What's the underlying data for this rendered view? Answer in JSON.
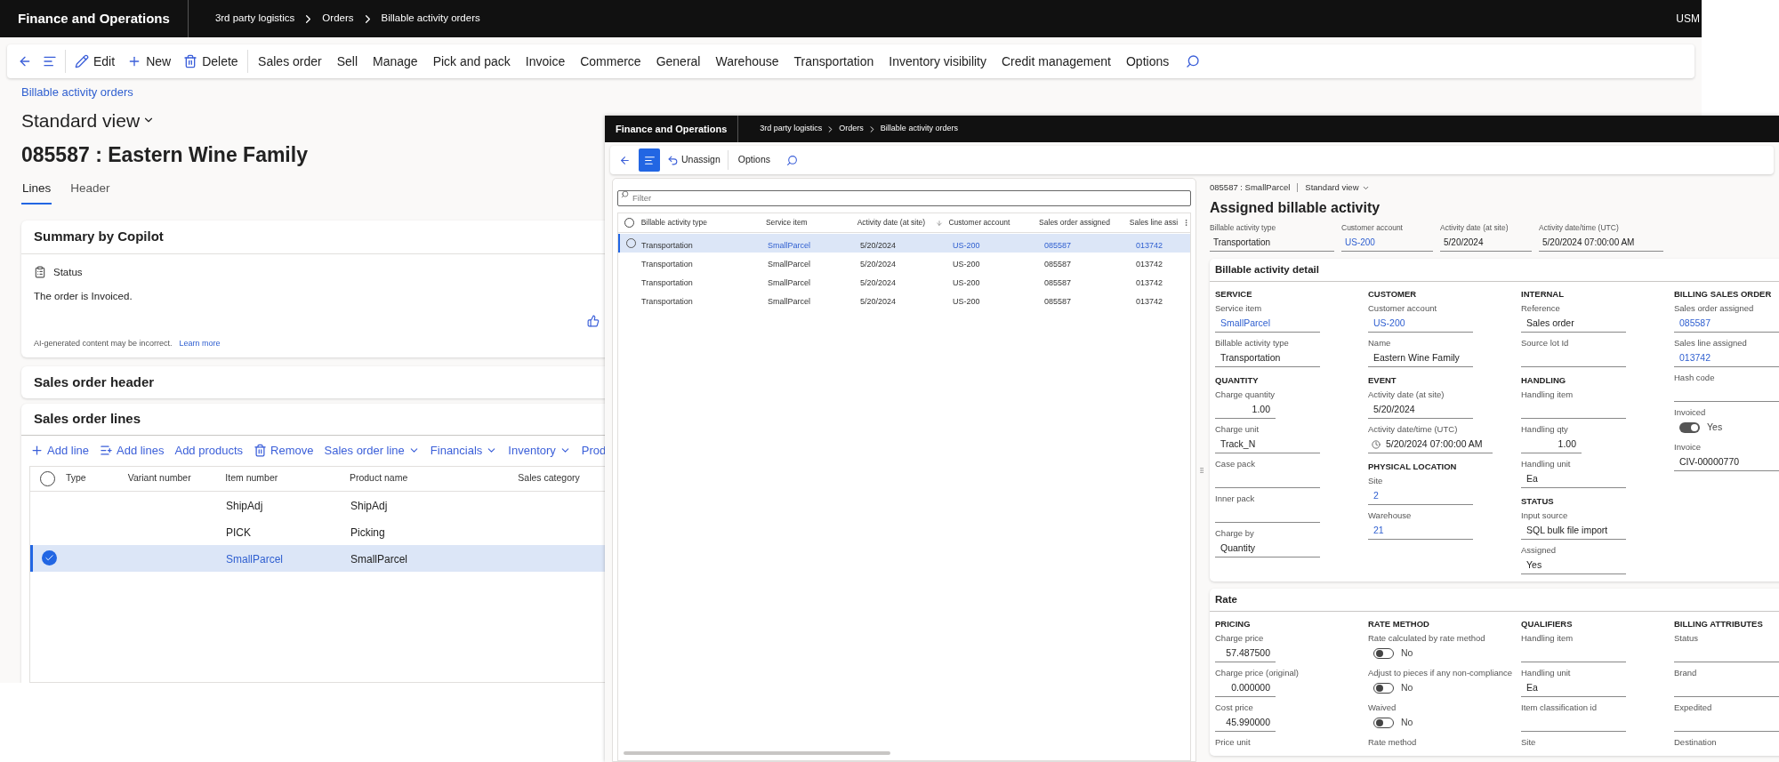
{
  "back_window": {
    "app_title": "Finance and Operations",
    "breadcrumb": [
      "3rd party logistics",
      "Orders",
      "Billable activity orders"
    ],
    "user": "USM",
    "toolbar": [
      {
        "kind": "back"
      },
      {
        "kind": "menu"
      },
      {
        "kind": "edit",
        "label": "Edit"
      },
      {
        "kind": "new",
        "label": "New"
      },
      {
        "kind": "delete",
        "label": "Delete"
      },
      {
        "kind": "text",
        "label": "Sales order"
      },
      {
        "kind": "text",
        "label": "Sell"
      },
      {
        "kind": "text",
        "label": "Manage"
      },
      {
        "kind": "text",
        "label": "Pick and pack"
      },
      {
        "kind": "text",
        "label": "Invoice"
      },
      {
        "kind": "text",
        "label": "Commerce"
      },
      {
        "kind": "text",
        "label": "General"
      },
      {
        "kind": "text",
        "label": "Warehouse"
      },
      {
        "kind": "text",
        "label": "Transportation"
      },
      {
        "kind": "text",
        "label": "Inventory visibility"
      },
      {
        "kind": "text",
        "label": "Credit management"
      },
      {
        "kind": "text",
        "label": "Options"
      },
      {
        "kind": "search"
      }
    ],
    "page_link": "Billable activity orders",
    "view": "Standard view",
    "title": "085587 : Eastern Wine Family",
    "tabs": [
      {
        "label": "Lines",
        "selected": true
      },
      {
        "label": "Header",
        "selected": false
      }
    ],
    "summary": {
      "title": "Summary by Copilot",
      "status_label": "Status",
      "text": "The order is Invoiced.",
      "disclaimer": "AI-generated content may be incorrect.",
      "link": "Learn more"
    },
    "header_section": {
      "title": "Sales order header"
    },
    "lines_section": {
      "title": "Sales order lines",
      "actions": [
        {
          "kind": "add",
          "label": "Add line"
        },
        {
          "kind": "add_multi",
          "label": "Add lines"
        },
        {
          "kind": "text",
          "label": "Add products"
        },
        {
          "kind": "remove",
          "label": "Remove"
        },
        {
          "kind": "dropdown",
          "label": "Sales order line"
        },
        {
          "kind": "dropdown",
          "label": "Financials"
        },
        {
          "kind": "dropdown",
          "label": "Inventory"
        },
        {
          "kind": "text",
          "label": "Prod"
        }
      ],
      "select_all": false,
      "columns": [
        "Type",
        "Variant number",
        "Item number",
        "Product name",
        "Sales category"
      ],
      "rows": [
        {
          "item_number": "ShipAdj",
          "product_name": "ShipAdj",
          "selected": false
        },
        {
          "item_number": "PICK",
          "product_name": "Picking",
          "selected": false
        },
        {
          "item_number": "SmallParcel",
          "product_name": "SmallParcel",
          "selected": true
        }
      ]
    }
  },
  "front_window": {
    "app_title": "Finance and Operations",
    "breadcrumb": [
      "3rd party logistics",
      "Orders",
      "Billable activity orders"
    ],
    "toolbar": [
      {
        "kind": "back"
      },
      {
        "kind": "menu_active"
      },
      {
        "kind": "unassign",
        "label": "Unassign"
      },
      {
        "kind": "text",
        "label": "Options"
      },
      {
        "kind": "search"
      }
    ],
    "list": {
      "filter_placeholder": "Filter",
      "select_all": false,
      "columns": [
        {
          "label": "Billable activity type",
          "link": false,
          "sorted": false
        },
        {
          "label": "Service item",
          "link": true,
          "sorted": false
        },
        {
          "label": "Activity date (at site)",
          "link": false,
          "sorted": true
        },
        {
          "label": "Customer account",
          "link": true,
          "sorted": false
        },
        {
          "label": "Sales order assigned",
          "link": true,
          "sorted": false
        },
        {
          "label": "Sales line assi",
          "link": true,
          "sorted": false
        }
      ],
      "rows": [
        {
          "cells": [
            "Transportation",
            "SmallParcel",
            "5/20/2024",
            "US-200",
            "085587",
            "013742"
          ],
          "selected": true
        },
        {
          "cells": [
            "Transportation",
            "SmallParcel",
            "5/20/2024",
            "US-200",
            "085587",
            "013742"
          ],
          "selected": false
        },
        {
          "cells": [
            "Transportation",
            "SmallParcel",
            "5/20/2024",
            "US-200",
            "085587",
            "013742"
          ],
          "selected": false
        },
        {
          "cells": [
            "Transportation",
            "SmallParcel",
            "5/20/2024",
            "US-200",
            "085587",
            "013742"
          ],
          "selected": false
        }
      ]
    },
    "record_label": "085587 : SmallParcel",
    "view": "Standard view",
    "title": "Assigned billable activity",
    "header_fields": [
      {
        "label": "Billable activity type",
        "value": "Transportation",
        "link": false
      },
      {
        "label": "Customer account",
        "value": "US-200",
        "link": true
      },
      {
        "label": "Activity date (at site)",
        "value": "5/20/2024",
        "link": false
      },
      {
        "label": "Activity date/time (UTC)",
        "value": "5/20/2024 07:00:00 AM",
        "link": false
      }
    ],
    "sections": [
      {
        "title": "Billable activity detail",
        "columns": [
          {
            "groups": [
              {
                "title": "SERVICE",
                "fields": [
                  {
                    "kind": "text",
                    "label": "Service item",
                    "value": "SmallParcel",
                    "link": true
                  },
                  {
                    "kind": "text",
                    "label": "Billable activity type",
                    "value": "Transportation",
                    "link": false
                  }
                ]
              },
              {
                "title": "QUANTITY",
                "fields": [
                  {
                    "kind": "number",
                    "label": "Charge quantity",
                    "value": "1.00"
                  },
                  {
                    "kind": "text",
                    "label": "Charge unit",
                    "value": "Track_N",
                    "link": false
                  },
                  {
                    "kind": "text",
                    "label": "Case pack"
                  },
                  {
                    "kind": "text",
                    "label": "Inner pack"
                  },
                  {
                    "kind": "text",
                    "label": "Charge by",
                    "value": "Quantity",
                    "link": false
                  }
                ]
              }
            ]
          },
          {
            "groups": [
              {
                "title": "CUSTOMER",
                "fields": [
                  {
                    "kind": "text",
                    "label": "Customer account",
                    "value": "US-200",
                    "link": true
                  },
                  {
                    "kind": "text",
                    "label": "Name",
                    "value": "Eastern Wine Family",
                    "link": false
                  }
                ]
              },
              {
                "title": "EVENT",
                "fields": [
                  {
                    "kind": "text",
                    "label": "Activity date (at site)",
                    "value": "5/20/2024",
                    "link": false
                  },
                  {
                    "kind": "datetime",
                    "label": "Activity date/time (UTC)",
                    "value": "5/20/2024 07:00:00 AM"
                  }
                ]
              },
              {
                "title": "PHYSICAL LOCATION",
                "fields": [
                  {
                    "kind": "text",
                    "label": "Site",
                    "value": "2",
                    "link": true
                  },
                  {
                    "kind": "text",
                    "label": "Warehouse",
                    "value": "21",
                    "link": true
                  }
                ]
              }
            ]
          },
          {
            "groups": [
              {
                "title": "INTERNAL",
                "fields": [
                  {
                    "kind": "text",
                    "label": "Reference",
                    "value": "Sales order",
                    "link": false
                  },
                  {
                    "kind": "text",
                    "label": "Source lot Id"
                  }
                ]
              },
              {
                "title": "HANDLING",
                "fields": [
                  {
                    "kind": "text",
                    "label": "Handling item"
                  },
                  {
                    "kind": "number",
                    "label": "Handling qty",
                    "value": "1.00"
                  },
                  {
                    "kind": "text",
                    "label": "Handling unit",
                    "value": "Ea",
                    "link": false
                  }
                ]
              },
              {
                "title": "STATUS",
                "fields": [
                  {
                    "kind": "text",
                    "label": "Input source",
                    "value": "SQL bulk file import",
                    "link": false
                  },
                  {
                    "kind": "text",
                    "label": "Assigned",
                    "value": "Yes",
                    "link": false
                  }
                ]
              }
            ]
          },
          {
            "groups": [
              {
                "title": "BILLING SALES ORDER",
                "fields": [
                  {
                    "kind": "text",
                    "label": "Sales order assigned",
                    "value": "085587",
                    "link": true
                  },
                  {
                    "kind": "text",
                    "label": "Sales line assigned",
                    "value": "013742",
                    "link": true
                  },
                  {
                    "kind": "text",
                    "label": "Hash code"
                  },
                  {
                    "kind": "toggle",
                    "label": "Invoiced",
                    "value": "Yes",
                    "on": true
                  },
                  {
                    "kind": "text",
                    "label": "Invoice",
                    "value": "CIV-00000770",
                    "link": false
                  }
                ]
              }
            ]
          }
        ]
      },
      {
        "title": "Rate",
        "columns": [
          {
            "groups": [
              {
                "title": "PRICING",
                "fields": [
                  {
                    "kind": "number",
                    "label": "Charge price",
                    "value": "57.487500"
                  },
                  {
                    "kind": "number",
                    "label": "Charge price (original)",
                    "value": "0.000000"
                  },
                  {
                    "kind": "number",
                    "label": "Cost price",
                    "value": "45.990000"
                  },
                  {
                    "kind": "partial",
                    "label": "Price unit"
                  }
                ]
              }
            ]
          },
          {
            "groups": [
              {
                "title": "RATE METHOD",
                "fields": [
                  {
                    "kind": "toggle",
                    "label": "Rate calculated by rate method",
                    "value": "No",
                    "on": false
                  },
                  {
                    "kind": "toggle",
                    "label": "Adjust to pieces if any non-compliance",
                    "value": "No",
                    "on": false
                  },
                  {
                    "kind": "toggle",
                    "label": "Waived",
                    "value": "No",
                    "on": false
                  },
                  {
                    "kind": "partial",
                    "label": "Rate method"
                  }
                ]
              }
            ]
          },
          {
            "groups": [
              {
                "title": "QUALIFIERS",
                "fields": [
                  {
                    "kind": "text",
                    "label": "Handling item"
                  },
                  {
                    "kind": "text",
                    "label": "Handling unit",
                    "value": "Ea",
                    "link": false
                  },
                  {
                    "kind": "text",
                    "label": "Item classification id"
                  },
                  {
                    "kind": "partial",
                    "label": "Site"
                  }
                ]
              }
            ]
          },
          {
            "groups": [
              {
                "title": "BILLING ATTRIBUTES",
                "fields": [
                  {
                    "kind": "text",
                    "label": "Status"
                  },
                  {
                    "kind": "text",
                    "label": "Brand"
                  },
                  {
                    "kind": "text",
                    "label": "Expedited"
                  },
                  {
                    "kind": "partial",
                    "label": "Destination"
                  }
                ]
              }
            ]
          }
        ]
      }
    ]
  }
}
